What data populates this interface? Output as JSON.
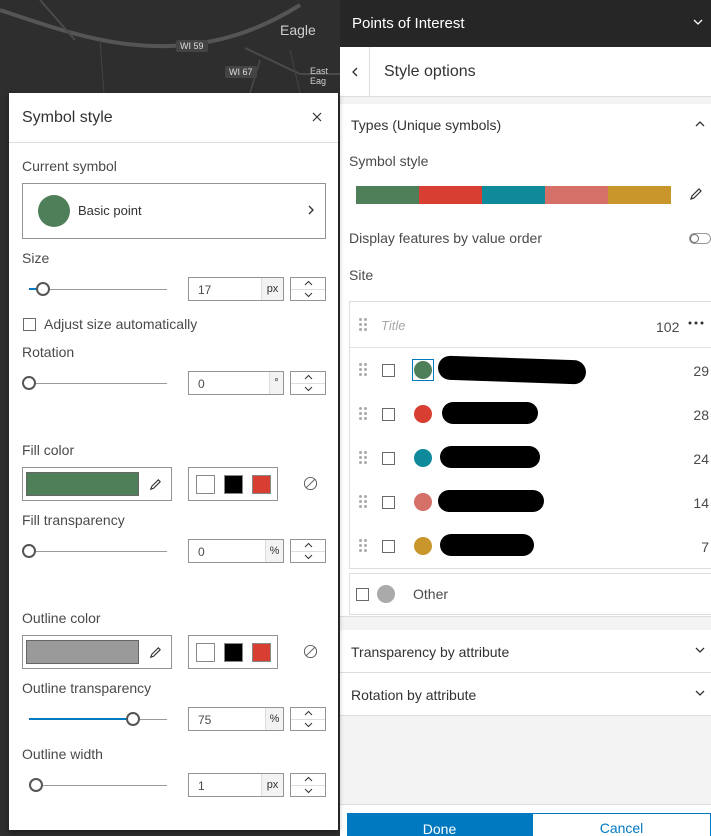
{
  "map": {
    "place_label": "Eagle",
    "road_labels": [
      "WI 59",
      "WI 67",
      "East Eag"
    ]
  },
  "panel": {
    "title": "Points of Interest",
    "subtitle": "Style options",
    "types_section": "Types (Unique symbols)",
    "symbol_style_label": "Symbol style",
    "ramp_colors": [
      "#4f7f58",
      "#d83f32",
      "#0f8a9a",
      "#d47068",
      "#c9962b"
    ],
    "display_order_label": "Display features by value order",
    "field_label": "Site",
    "list": {
      "title_placeholder": "Title",
      "total": "102",
      "rows": [
        {
          "color": "#4f7f58",
          "count": "29"
        },
        {
          "color": "#d83f32",
          "count": "28"
        },
        {
          "color": "#0f8a9a",
          "count": "24"
        },
        {
          "color": "#d47068",
          "count": "14"
        },
        {
          "color": "#c9962b",
          "count": "7"
        }
      ],
      "other_label": "Other",
      "other_color": "#aaaaaa"
    },
    "transparency_section": "Transparency by attribute",
    "rotation_section": "Rotation by attribute",
    "done_label": "Done",
    "cancel_label": "Cancel",
    "accent": "#0079c1"
  },
  "popup": {
    "title": "Symbol style",
    "current_symbol_label": "Current symbol",
    "symbol_name": "Basic point",
    "symbol_color": "#4f7f58",
    "size_label": "Size",
    "size_value": "17",
    "size_unit": "px",
    "size_level": 0.1,
    "adjust_label": "Adjust size automatically",
    "rotation_label": "Rotation",
    "rotation_value": "0",
    "rotation_unit": "°",
    "rotation_level": 0,
    "fill_color_label": "Fill color",
    "fill_color": "#4f7f58",
    "fill_transparency_label": "Fill transparency",
    "fill_transparency_value": "0",
    "fill_transparency_unit": "%",
    "fill_transparency_level": 0,
    "outline_color_label": "Outline color",
    "outline_color": "#9a9a9a",
    "outline_transparency_label": "Outline transparency",
    "outline_transparency_value": "75",
    "outline_transparency_unit": "%",
    "outline_transparency_level": 0.75,
    "outline_width_label": "Outline width",
    "outline_width_value": "1",
    "outline_width_unit": "px",
    "outline_width_level": 0.05,
    "preset_colors": [
      "#ffffff",
      "#000000",
      "#d83f32"
    ]
  }
}
